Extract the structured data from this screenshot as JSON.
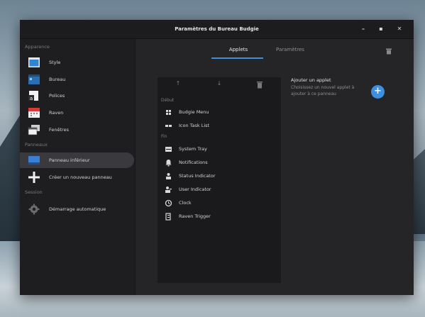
{
  "window": {
    "title": "Paramètres du Bureau Budgie"
  },
  "window_controls": {
    "minimize": "–",
    "maximize": "▪",
    "close": "✕"
  },
  "sidebar": {
    "sections": [
      {
        "label": "Apparence"
      },
      {
        "label": "Panneaux"
      },
      {
        "label": "Session"
      }
    ],
    "items": [
      {
        "label": "Style",
        "icon": "style-icon"
      },
      {
        "label": "Bureau",
        "icon": "desktop-icon"
      },
      {
        "label": "Polices",
        "icon": "fonts-icon"
      },
      {
        "label": "Raven",
        "icon": "raven-calendar-icon"
      },
      {
        "label": "Fenêtres",
        "icon": "windows-icon"
      },
      {
        "label": "Panneau inférieur",
        "icon": "panel-icon",
        "selected": true
      },
      {
        "label": "Créer un nouveau panneau",
        "icon": "plus-icon"
      },
      {
        "label": "Démarrage automatique",
        "icon": "autostart-gear-icon"
      }
    ]
  },
  "tabs": [
    {
      "label": "Applets",
      "selected": true
    },
    {
      "label": "Paramètres",
      "selected": false
    }
  ],
  "applet_list": {
    "toolbar": {
      "move_up": "↑",
      "move_down": "↓",
      "remove": "🗑"
    },
    "sections": [
      {
        "label": "Début",
        "items": [
          {
            "label": "Budgie Menu",
            "icon": "grid-icon"
          },
          {
            "label": "Icon Task List",
            "icon": "tasklist-icon"
          }
        ]
      },
      {
        "label": "Fin",
        "items": [
          {
            "label": "System Tray",
            "icon": "tray-icon"
          },
          {
            "label": "Notifications",
            "icon": "bell-icon"
          },
          {
            "label": "Status Indicator",
            "icon": "status-icon"
          },
          {
            "label": "User Indicator",
            "icon": "user-icon"
          },
          {
            "label": "Clock",
            "icon": "clock-icon"
          },
          {
            "label": "Raven Trigger",
            "icon": "raven-trigger-icon"
          }
        ]
      }
    ]
  },
  "add_applet": {
    "title": "Ajouter un applet",
    "description": "Choisissez un nouvel applet à ajouter à ce panneau",
    "button": "+"
  },
  "colors": {
    "accent": "#3d8fe0",
    "window_bg": "#252527",
    "sidebar_bg": "#1e1e20"
  }
}
